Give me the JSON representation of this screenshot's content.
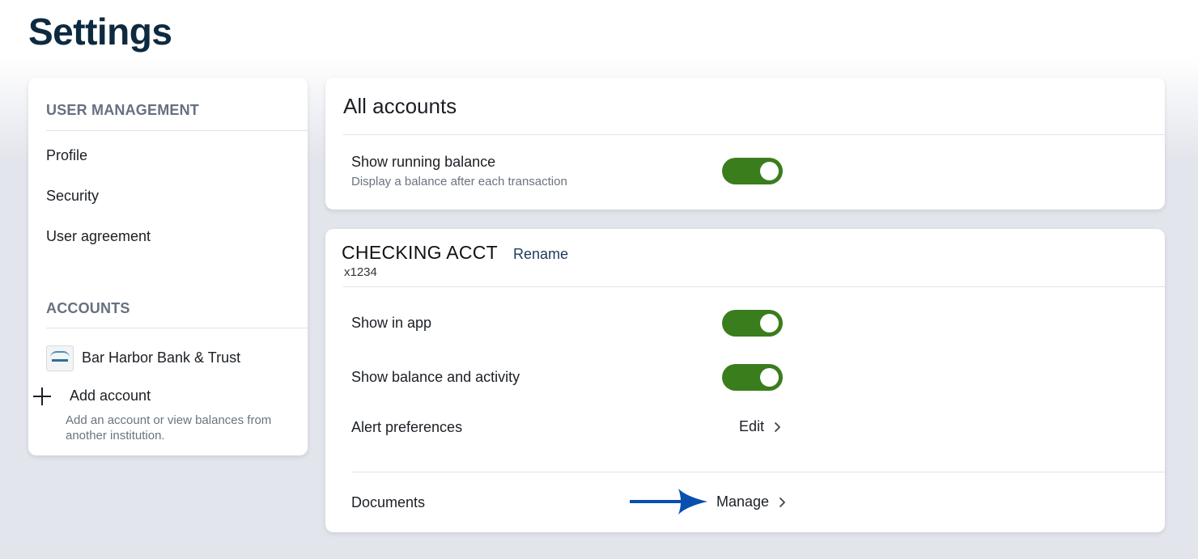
{
  "page": {
    "title": "Settings"
  },
  "sidebar": {
    "user_management": {
      "label": "USER MANAGEMENT",
      "items": [
        {
          "label": "Profile"
        },
        {
          "label": "Security"
        },
        {
          "label": "User agreement"
        }
      ]
    },
    "accounts": {
      "label": "ACCOUNTS",
      "bank_name": "Bar Harbor Bank & Trust",
      "add_account_label": "Add account",
      "add_account_desc": "Add an account or view balances from another institution."
    }
  },
  "all_accounts": {
    "title": "All accounts",
    "running_balance": {
      "label": "Show running balance",
      "desc": "Display a balance after each transaction",
      "enabled": true
    }
  },
  "checking": {
    "name": "CHECKING ACCT",
    "rename_label": "Rename",
    "mask": "x1234",
    "show_in_app": {
      "label": "Show in app",
      "enabled": true
    },
    "show_balance": {
      "label": "Show balance and activity",
      "enabled": true
    },
    "alert_preferences": {
      "label": "Alert preferences",
      "action": "Edit"
    },
    "documents": {
      "label": "Documents",
      "action": "Manage"
    }
  },
  "colors": {
    "toggle_on": "#3a7d1c",
    "title": "#0e2a40",
    "arrow": "#0a4fb0"
  },
  "icons": [
    "plus-icon",
    "chevron-right-icon",
    "arrow-right-icon",
    "bank-logo-icon"
  ]
}
